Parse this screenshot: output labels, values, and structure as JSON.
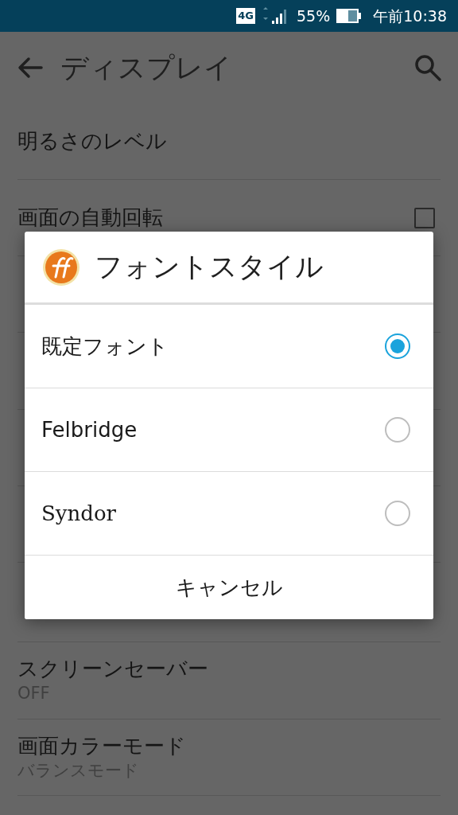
{
  "status_bar": {
    "network": "4G",
    "battery": "55%",
    "time": "午前10:38"
  },
  "toolbar": {
    "title": "ディスプレイ"
  },
  "settings": [
    {
      "kind": "plain",
      "title": "明るさのレベル"
    },
    {
      "kind": "checkbox",
      "title": "画面の自動回転",
      "checked": false
    },
    {
      "kind": "hidden"
    },
    {
      "kind": "hidden"
    },
    {
      "kind": "hidden"
    },
    {
      "kind": "hidden"
    },
    {
      "kind": "tall_hidden"
    },
    {
      "kind": "summary",
      "title": "スクリーンセーバー",
      "summary": "OFF"
    },
    {
      "kind": "summary",
      "title": "画面カラーモード",
      "summary": "バランスモード"
    }
  ],
  "dialog": {
    "title": "フォントスタイル",
    "options": [
      {
        "label": "既定フォント",
        "selected": true
      },
      {
        "label": "Felbridge",
        "selected": false
      },
      {
        "label": "Syndor",
        "selected": false
      }
    ],
    "cancel": "キャンセル"
  }
}
